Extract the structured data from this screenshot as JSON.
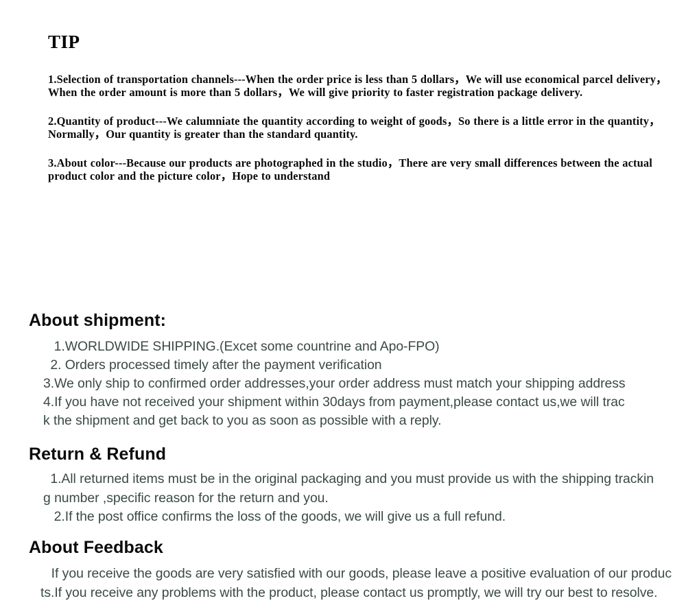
{
  "tip": {
    "title": "TIP",
    "paragraphs": [
      "1.Selection of transportation channels---When the order price is less than 5 dollars，We will use economical parcel delivery，When the order amount is more than 5 dollars，We will give priority to faster registration package delivery.",
      "2.Quantity of product---We calumniate the quantity according to weight of goods，So there is a little error in the quantity，Normally，Our quantity is greater than the standard quantity.",
      "3.About color---Because our products are photographed in the studio，There are very small differences between the actual product color and the picture color，Hope to understand"
    ]
  },
  "sections": [
    {
      "id": "shipment",
      "heading": "About shipment:",
      "lines": [
        "  1.WORLDWIDE SHIPPING.(Excet some countrine and Apo-FPO)",
        " 2. Orders processed timely after the payment verification",
        "3.We only ship to confirmed order addresses,your order address must match your shipping address",
        "4.If you have not received your shipment within 30days from payment,please contact us,we will trac",
        "k the shipment and get back to you as soon as possible with a reply."
      ]
    },
    {
      "id": "return",
      "heading": "Return & Refund",
      "lines": [
        " 1.All returned items must be in the original packaging and you must provide us with the shipping trackin",
        "g number ,specific reason for the return and you.",
        "  2.If the post office confirms the loss of the goods, we will give us a full refund."
      ]
    },
    {
      "id": "feedback",
      "heading": "About Feedback",
      "lines": [
        "  If you receive the goods are very satisfied with our goods, please leave a positive evaluation of our produc",
        "ts.If you receive any problems with the product, please contact us promptly, we will try our best to resolve."
      ]
    }
  ],
  "colors": {
    "background": "#ffffff",
    "tip_text": "#0a0a0a",
    "heading_text": "#0b0b0b",
    "body_text": "#3a4a44"
  }
}
